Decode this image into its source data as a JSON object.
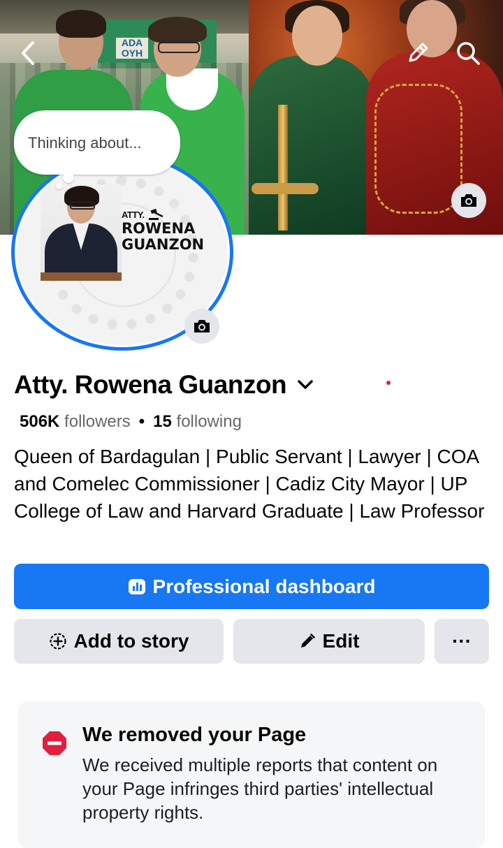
{
  "cover": {
    "banner_text": "ADA OYH"
  },
  "thought_bubble": {
    "text": "Thinking about..."
  },
  "profile_picture": {
    "logo_prefix": "ATTY.",
    "logo_line1": "ROWENA",
    "logo_line2": "GUANZON"
  },
  "profile": {
    "name": "Atty. Rowena Guanzon",
    "followers_count": "506K",
    "followers_label": "followers",
    "separator": "•",
    "following_count": "15",
    "following_label": "following",
    "bio": "Queen of Bardagulan | Public Servant | Lawyer | COA and Comelec Commissioner | Cadiz City Mayor | UP College of Law and Harvard Graduate | Law Professor"
  },
  "buttons": {
    "dashboard": "Professional dashboard",
    "add_story": "Add to story",
    "edit": "Edit",
    "more": "···"
  },
  "notice": {
    "title": "We removed your Page",
    "body": "We received multiple reports that content on your Page infringes third parties' intellectual property rights."
  },
  "colors": {
    "accent": "#1877f2",
    "button_gray": "#e4e6eb",
    "stop_red": "#e41e3f"
  },
  "icons": {
    "back": "back-chevron-icon",
    "edit_cover": "pencil-icon",
    "search": "search-icon",
    "camera": "camera-icon",
    "name_menu": "chevron-down-icon",
    "dashboard": "dashboard-icon",
    "add_story": "add-story-icon",
    "edit": "pencil-icon",
    "warning": "stop-icon"
  }
}
